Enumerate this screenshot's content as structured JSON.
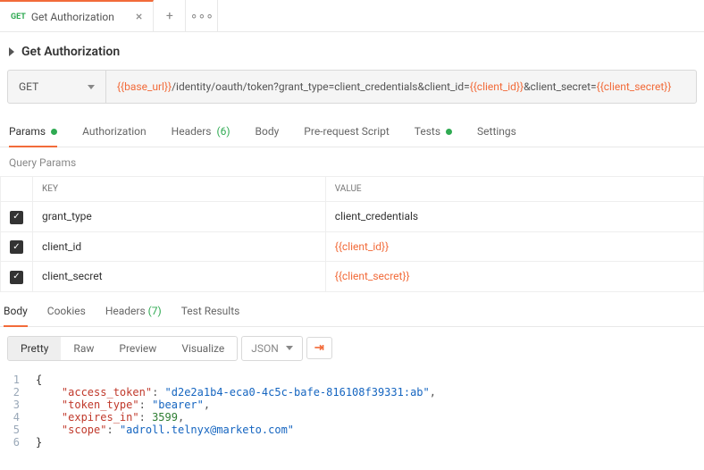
{
  "tab": {
    "method": "GET",
    "name": "Get Authorization"
  },
  "title": "Get Authorization",
  "url": {
    "method": "GET",
    "parts": [
      {
        "t": "var",
        "v": "{{base_url}}"
      },
      {
        "t": "txt",
        "v": "/identity/oauth/token?grant_type=client_credentials&client_id="
      },
      {
        "t": "var",
        "v": "{{client_id}}"
      },
      {
        "t": "txt",
        "v": "&client_secret="
      },
      {
        "t": "var",
        "v": "{{client_secret}}"
      }
    ]
  },
  "subtabs": {
    "params": "Params",
    "authorization": "Authorization",
    "headers": "Headers",
    "headers_count": "(6)",
    "body": "Body",
    "prerequest": "Pre-request Script",
    "tests": "Tests",
    "settings": "Settings"
  },
  "query_params": {
    "label": "Query Params",
    "key_header": "KEY",
    "value_header": "VALUE",
    "rows": [
      {
        "key": "grant_type",
        "value": "client_credentials",
        "is_var": false
      },
      {
        "key": "client_id",
        "value": "{{client_id}}",
        "is_var": true
      },
      {
        "key": "client_secret",
        "value": "{{client_secret}}",
        "is_var": true
      }
    ]
  },
  "response": {
    "tabs": {
      "body": "Body",
      "cookies": "Cookies",
      "headers": "Headers",
      "headers_count": "(7)",
      "test_results": "Test Results"
    },
    "toolbar": {
      "pretty": "Pretty",
      "raw": "Raw",
      "preview": "Preview",
      "visualize": "Visualize",
      "format": "JSON"
    },
    "json": {
      "access_token": "d2e2a1b4-eca0-4c5c-bafe-816108f39331:ab",
      "token_type": "bearer",
      "expires_in": 3599,
      "scope": "adroll.telnyx@marketo.com"
    }
  }
}
